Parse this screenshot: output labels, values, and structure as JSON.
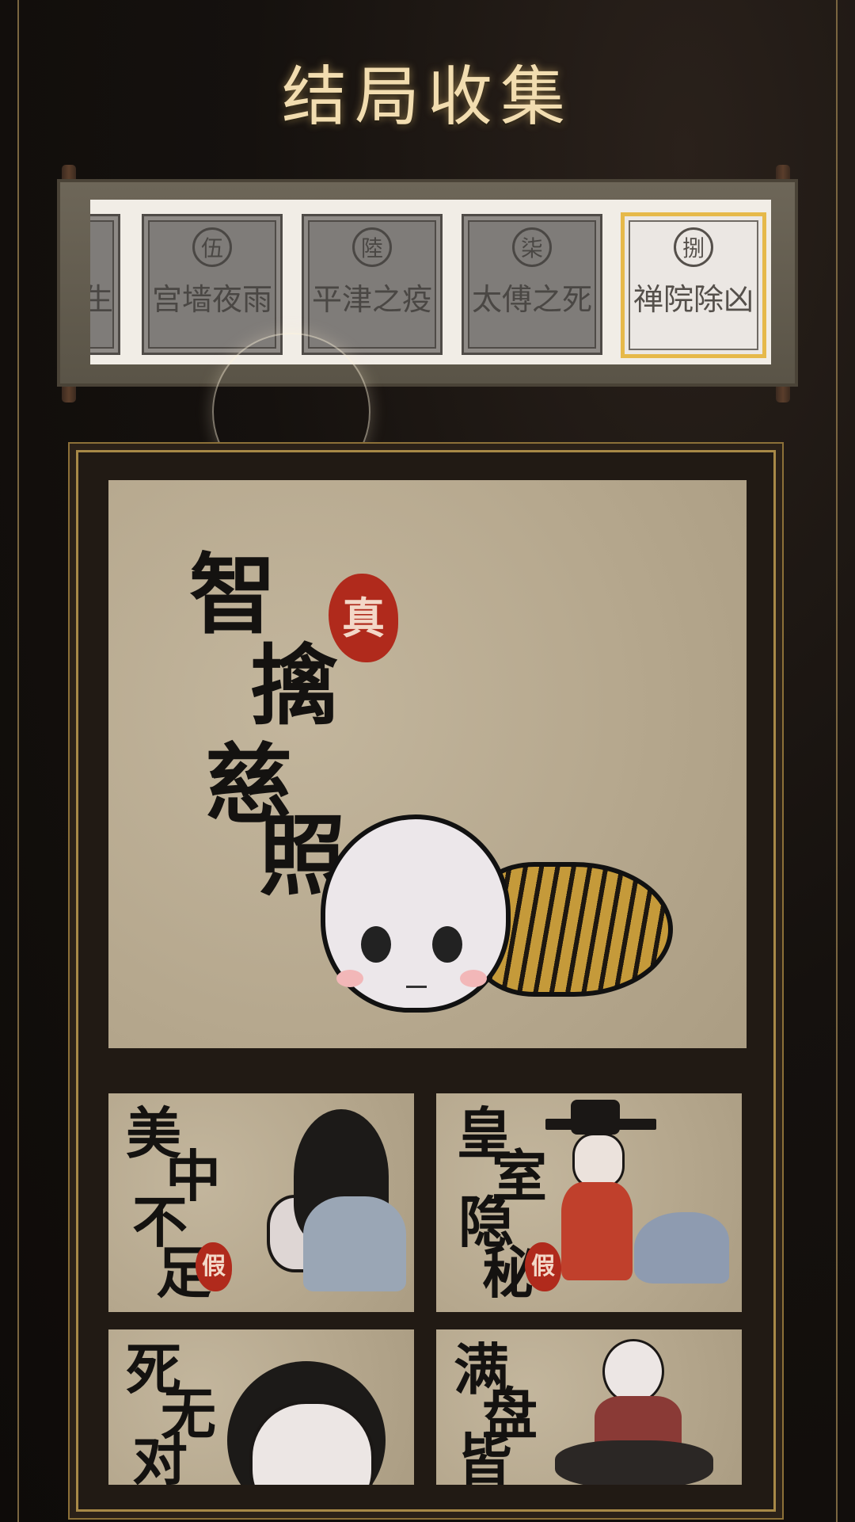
{
  "title": "结局收集",
  "tabs": [
    {
      "num": "",
      "name": "生",
      "state": "locked"
    },
    {
      "num": "伍",
      "name": "宫墙夜雨",
      "state": "locked"
    },
    {
      "num": "陸",
      "name": "平津之疫",
      "state": "locked"
    },
    {
      "num": "柒",
      "name": "太傅之死",
      "state": "locked"
    },
    {
      "num": "捌",
      "name": "禅院除凶",
      "state": "selected"
    }
  ],
  "hero": {
    "title_chars": [
      "智",
      "擒",
      "慈",
      "照"
    ],
    "seal": "真"
  },
  "endings": [
    {
      "title_chars": [
        "美",
        "中",
        "不",
        "足"
      ],
      "seal": "假"
    },
    {
      "title_chars": [
        "皇",
        "室",
        "隐",
        "秘"
      ],
      "seal": "假"
    },
    {
      "title_chars": [
        "死",
        "无",
        "对"
      ],
      "seal": ""
    },
    {
      "title_chars": [
        "满",
        "盘",
        "皆"
      ],
      "seal": ""
    }
  ],
  "colors": {
    "accent": "#e6b94a",
    "seal": "#b02a1c",
    "paper": "#b8aa91"
  }
}
